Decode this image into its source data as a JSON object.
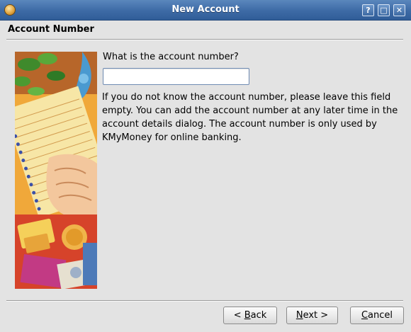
{
  "window": {
    "title": "New Account",
    "buttons": [
      {
        "name": "help",
        "glyph": "?"
      },
      {
        "name": "maximize",
        "glyph": "□"
      },
      {
        "name": "close",
        "glyph": "✕"
      }
    ]
  },
  "page": {
    "title": "Account Number",
    "question": "What is the account number?",
    "account_number_value": "",
    "help_text": "If you do not know the account number, please leave this field empty. You can add the account number at any later time in the account details dialog. The account number is only used by KMyMoney for online banking."
  },
  "buttons": {
    "back": {
      "mnemonic": "B",
      "rest": "ack",
      "prefix": "< "
    },
    "next": {
      "mnemonic": "N",
      "rest": "ext >"
    },
    "cancel": {
      "mnemonic": "C",
      "rest": "ancel"
    }
  },
  "icons": {
    "app": "kmymoney-app-icon",
    "side_image": "finance-illustration"
  },
  "colors": {
    "titlebar": "#3d6aa5",
    "background": "#e3e3e3",
    "input_border": "#6f8bb3"
  }
}
